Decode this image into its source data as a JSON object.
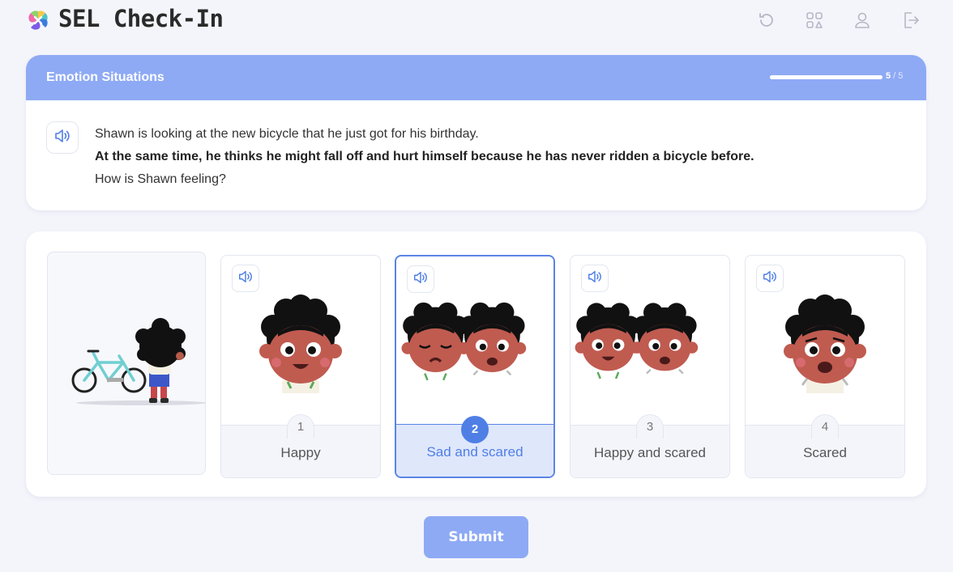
{
  "app": {
    "title": "SEL Check-In"
  },
  "header_icons": [
    "refresh-icon",
    "grid-icon",
    "user-icon",
    "logout-icon"
  ],
  "question": {
    "section_title": "Emotion Situations",
    "progress": {
      "current": "5",
      "total": "5",
      "sep": " / "
    },
    "lines": [
      "Shawn is looking at the new bicycle that he just got for his birthday.",
      "At the same time, he thinks he might fall off and hurt himself because he has never ridden a bicycle before.",
      "How is Shawn feeling?"
    ]
  },
  "answers": [
    {
      "number": "1",
      "label": "Happy",
      "selected": false
    },
    {
      "number": "2",
      "label": "Sad and scared",
      "selected": true
    },
    {
      "number": "3",
      "label": "Happy and scared",
      "selected": false
    },
    {
      "number": "4",
      "label": "Scared",
      "selected": false
    }
  ],
  "submit_label": "Submit",
  "colors": {
    "accent": "#8eaaf5",
    "selected": "#4f7fe5",
    "background": "#f4f5fb"
  }
}
